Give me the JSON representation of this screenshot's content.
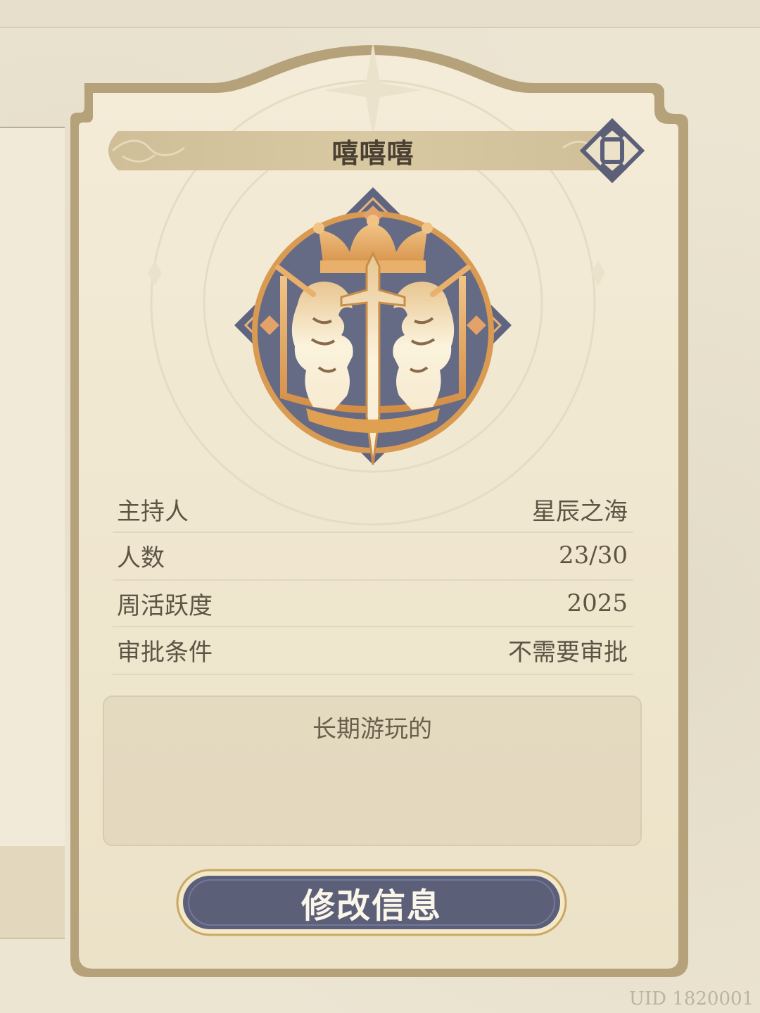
{
  "guild": {
    "name": "嘻嘻嘻",
    "info": [
      {
        "label": "主持人",
        "value": "星辰之海"
      },
      {
        "label": "人数",
        "value": "23/30"
      },
      {
        "label": "周活跃度",
        "value": "2025"
      },
      {
        "label": "审批条件",
        "value": "不需要审批"
      }
    ],
    "description": "长期游玩的",
    "edit_button_label": "修改信息",
    "emblem_icon": "crowned-lions-sword-crest-icon",
    "swap_icon": "swap-emblem-icon"
  },
  "footer": {
    "uid": "UID 1820001"
  },
  "colors": {
    "frame": "#b5a27a",
    "card": "#f1e7cf",
    "button": "#5c5f78",
    "crest_navy": "#626781",
    "crest_gold": "#dca25c"
  }
}
